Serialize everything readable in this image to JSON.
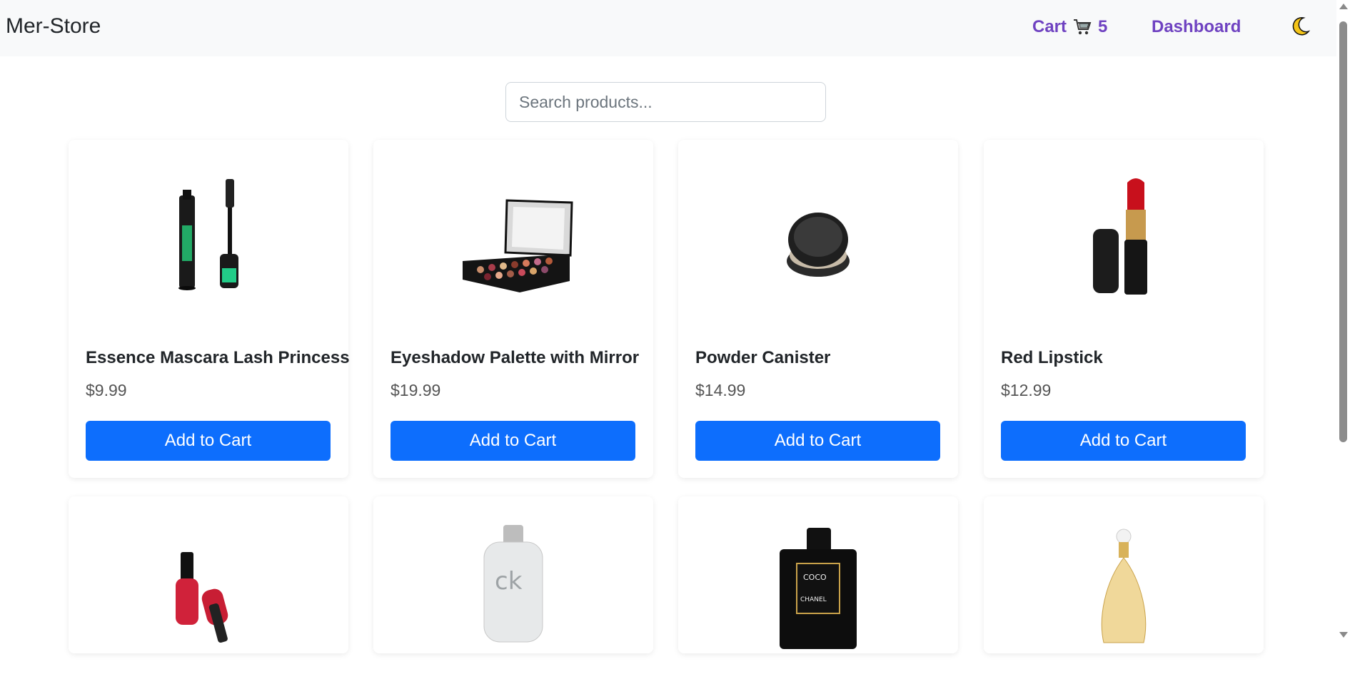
{
  "navbar": {
    "brand": "Mer-Store",
    "cart_label": "Cart",
    "cart_count": "5",
    "dashboard_label": "Dashboard",
    "theme_icon": "moon-icon"
  },
  "search": {
    "placeholder": "Search products..."
  },
  "products": [
    {
      "title": "Essence Mascara Lash Princess",
      "price": "$9.99",
      "button": "Add to Cart"
    },
    {
      "title": "Eyeshadow Palette with Mirror",
      "price": "$19.99",
      "button": "Add to Cart"
    },
    {
      "title": "Powder Canister",
      "price": "$14.99",
      "button": "Add to Cart"
    },
    {
      "title": "Red Lipstick",
      "price": "$12.99",
      "button": "Add to Cart"
    },
    {
      "title": "",
      "price": "",
      "button": ""
    },
    {
      "title": "",
      "price": "",
      "button": ""
    },
    {
      "title": "",
      "price": "",
      "button": ""
    },
    {
      "title": "",
      "price": "",
      "button": ""
    }
  ],
  "colors": {
    "accent": "#0d6efd",
    "nav_link": "#6f42c1",
    "navbar_bg": "#f8f9fa"
  }
}
